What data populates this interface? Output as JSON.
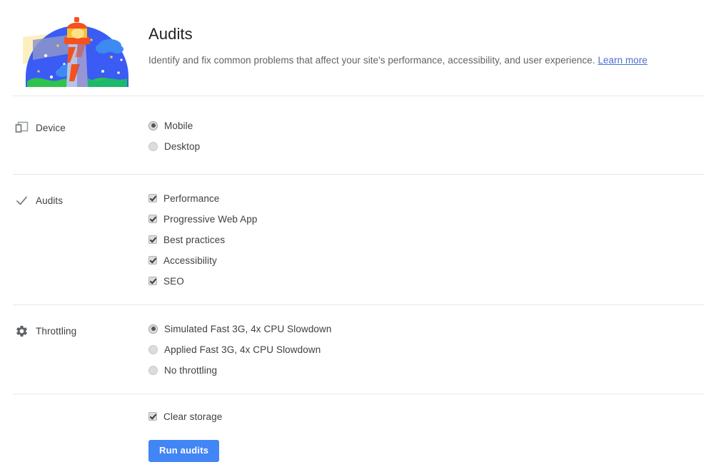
{
  "header": {
    "logo_name": "lighthouse-logo",
    "title": "Audits",
    "description": "Identify and fix common problems that affect your site's performance, accessibility, and user experience.",
    "learn_more_label": "Learn more"
  },
  "sections": [
    {
      "id": "device",
      "icon": "devices-icon",
      "title": "Device",
      "control_type": "radio",
      "options": [
        {
          "label": "Mobile",
          "selected": true
        },
        {
          "label": "Desktop",
          "selected": false
        }
      ]
    },
    {
      "id": "audits",
      "icon": "checkmark-icon",
      "title": "Audits",
      "control_type": "checkbox",
      "options": [
        {
          "label": "Performance",
          "checked": true
        },
        {
          "label": "Progressive Web App",
          "checked": true
        },
        {
          "label": "Best practices",
          "checked": true
        },
        {
          "label": "Accessibility",
          "checked": true
        },
        {
          "label": "SEO",
          "checked": true
        }
      ]
    },
    {
      "id": "throttling",
      "icon": "gear-icon",
      "title": "Throttling",
      "control_type": "radio",
      "options": [
        {
          "label": "Simulated Fast 3G, 4x CPU Slowdown",
          "selected": true
        },
        {
          "label": "Applied Fast 3G, 4x CPU Slowdown",
          "selected": false
        },
        {
          "label": "No throttling",
          "selected": false
        }
      ]
    }
  ],
  "footer": {
    "clear_storage": {
      "label": "Clear storage",
      "checked": true
    },
    "run_button_label": "Run audits"
  },
  "colors": {
    "accent_blue": "#4285f4",
    "link_blue": "#4a6fd4",
    "text_primary": "#202124",
    "text_secondary": "#5f6368",
    "divider": "#e6e6e6"
  }
}
